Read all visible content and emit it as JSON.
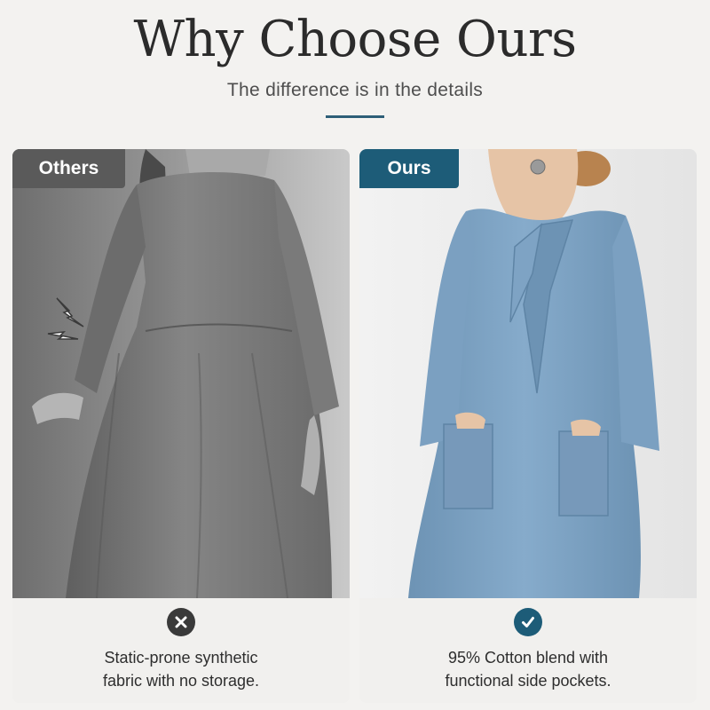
{
  "header": {
    "title": "Why Choose Ours",
    "subtitle": "The difference is in the details"
  },
  "colors": {
    "accent": "#1d5c78",
    "others_badge": "#5a5a5a",
    "others_dress": "#7d7d7d",
    "ours_dress": "#7ea3c4"
  },
  "panels": {
    "others": {
      "badge": "Others",
      "icon": "x-circle-icon",
      "caption_line1": "Static-prone synthetic",
      "caption_line2": "fabric with no storage."
    },
    "ours": {
      "badge": "Ours",
      "icon": "check-circle-icon",
      "caption_line1": "95% Cotton blend with",
      "caption_line2": "functional side pockets."
    }
  }
}
